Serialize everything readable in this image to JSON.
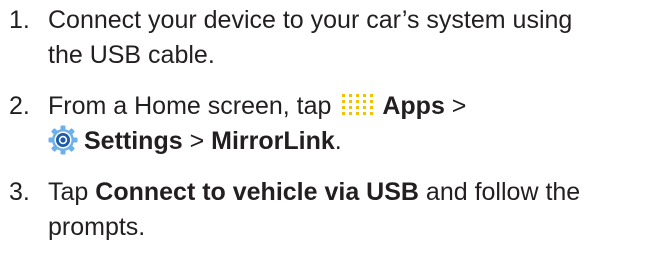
{
  "steps": [
    {
      "number": "1.",
      "line1": "Connect your device to your car’s system using",
      "line2": "the USB cable."
    },
    {
      "number": "2.",
      "prefix": "From a Home screen, tap",
      "apps_label": "Apps",
      "sep1": ">",
      "settings_label": "Settings",
      "sep2": ">",
      "mirrorlink_label": "MirrorLink",
      "end": "."
    },
    {
      "number": "3.",
      "prefix": "Tap",
      "bold": "Connect to vehicle via USB",
      "suffix": "and follow the",
      "line2": "prompts."
    }
  ],
  "icons": {
    "apps": "apps-grid-icon",
    "settings": "settings-gear-icon"
  },
  "colors": {
    "text": "#231f20",
    "apps_icon": "#f2c200",
    "settings_outer": "#6eb1ea",
    "settings_inner": "#1d5bab"
  }
}
